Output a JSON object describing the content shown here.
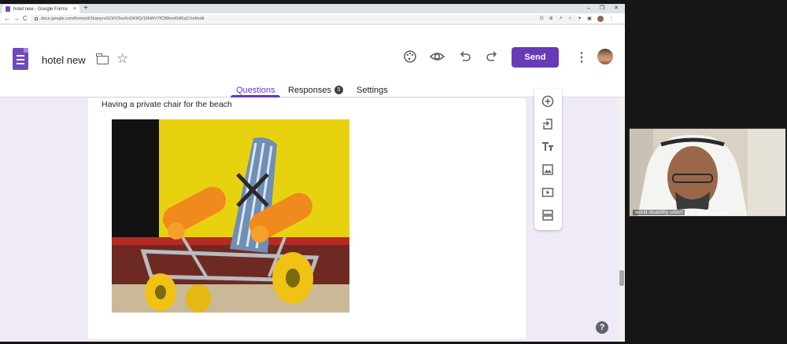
{
  "browser": {
    "tab_title": "hotel new - Google Forms",
    "tab_close": "×",
    "new_tab": "+",
    "window_controls": [
      "–",
      "❐",
      "✕"
    ],
    "nav": {
      "back": "←",
      "forward": "→",
      "reload": "C"
    },
    "url": "docs.google.com/forms/d/1kqoyrvGOt/V3ocKnDK6Q/19hWV7fC89km/0dRzjC/ref/edit",
    "omni_icons": [
      "G",
      "⊕",
      "↗",
      "☆",
      "✦",
      "▣"
    ]
  },
  "header": {
    "doc_title": "hotel new",
    "send_label": "Send",
    "icons": [
      "palette-icon",
      "eye-icon",
      "undo-icon",
      "redo-icon",
      "more-vert-icon",
      "folder-icon",
      "star-icon"
    ]
  },
  "tabs": {
    "questions": "Questions",
    "responses": "Responses",
    "responses_count": "5",
    "settings": "Settings"
  },
  "form": {
    "question_title": "Having a private chair for the beach"
  },
  "toolbar": {
    "items": [
      "add-question-icon",
      "import-questions-icon",
      "add-title-icon",
      "add-image-icon",
      "add-video-icon",
      "add-section-icon"
    ]
  },
  "help": {
    "label": "?"
  },
  "video": {
    "participant_label": "world disability union"
  },
  "colors": {
    "accent": "#673ab7",
    "page_bg": "#f0eaf7",
    "photo_yellow": "#e8d210",
    "chair_orange": "#f08a1c"
  }
}
